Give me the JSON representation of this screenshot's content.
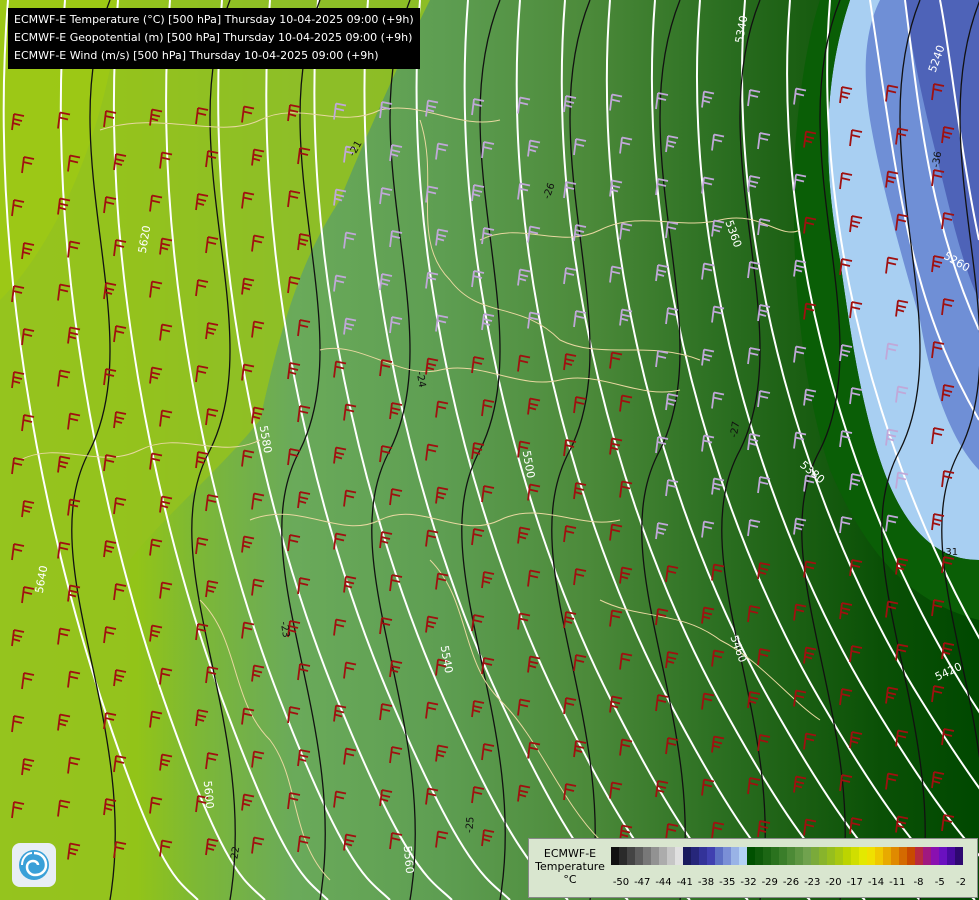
{
  "titles": [
    "ECMWF-E Temperature (°C) [500 hPa] Thursday 10-04-2025 09:00 (+9h)",
    "ECMWF-E Geopotential (m) [500 hPa] Thursday 10-04-2025 09:00 (+9h)",
    "ECMWF-E Wind (m/s) [500 hPa] Thursday 10-04-2025 09:00 (+9h)"
  ],
  "geopotential_labels": [
    "5240",
    "5260",
    "5340",
    "5360",
    "5380",
    "5420",
    "5460",
    "5500",
    "5540",
    "5560",
    "5580",
    "5600",
    "5620",
    "5640"
  ],
  "temperature_labels": [
    "-21",
    "-22",
    "-23",
    "-24",
    "-25",
    "-26",
    "-27",
    "-31",
    "-36"
  ],
  "legend": {
    "title_line1": "ECMWF-E",
    "title_line2": "Temperature",
    "unit": "°C",
    "ticks": [
      "-50",
      "-47",
      "-44",
      "-41",
      "-38",
      "-35",
      "-32",
      "-29",
      "-26",
      "-23",
      "-20",
      "-17",
      "-14",
      "-11",
      "-8",
      "-5",
      "-2"
    ],
    "colors": [
      "#111111",
      "#2a2a2a",
      "#444444",
      "#5e5e5e",
      "#787878",
      "#929292",
      "#acacac",
      "#c6c6c6",
      "#e0e0e0",
      "#1a1a5e",
      "#26267a",
      "#333399",
      "#4040b0",
      "#5c6fc4",
      "#7a8fd6",
      "#99b3e6",
      "#b3d1f5",
      "#005000",
      "#0e5a0a",
      "#1c6614",
      "#2a721e",
      "#3a7e2a",
      "#4c8a36",
      "#5e9642",
      "#70a24e",
      "#7aaa3a",
      "#88b42c",
      "#96be1e",
      "#a8c810",
      "#bcd400",
      "#d0de00",
      "#e4e800",
      "#f0e000",
      "#f0c800",
      "#e8aa00",
      "#e08a00",
      "#d46a00",
      "#c84a00",
      "#b82a40",
      "#a01880",
      "#8a10b0",
      "#6a10c0",
      "#4a0aa0",
      "#2e0870"
    ]
  },
  "logo_icon": "ecmwf-swirl-icon",
  "colors": {
    "wind_barb_warm": "#a01010",
    "wind_barb_cold": "#c0a8d8",
    "geopotential_contour": "#ffffff",
    "temperature_contour": "#111111",
    "border": "#e8d8a0"
  }
}
